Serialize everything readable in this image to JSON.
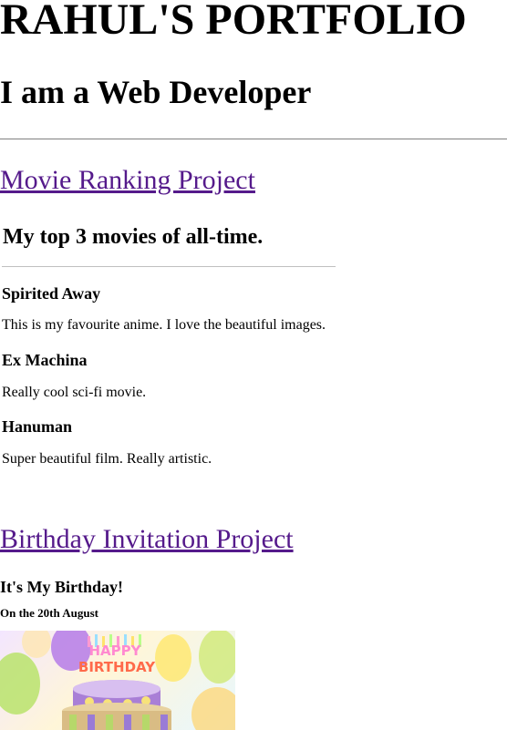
{
  "header": {
    "title": "RAHUL'S PORTFOLIO",
    "subtitle": "I am a Web Developer"
  },
  "projects": {
    "movie": {
      "link_label": "Movie Ranking Project",
      "heading": "My top 3 movies of all-time.",
      "movies": [
        {
          "title": "Spirited Away",
          "description": "This is my favourite anime. I love the beautiful images."
        },
        {
          "title": "Ex Machina",
          "description": "Really cool sci-fi movie."
        },
        {
          "title": "Hanuman",
          "description": "Super beautiful film. Really artistic."
        }
      ]
    },
    "birthday": {
      "link_label": "Birthday Invitation Project",
      "heading": "It's My Birthday!",
      "date": "On the 20th August",
      "image_text": {
        "line1": "HAPPY",
        "line2": "BIRTHDAY"
      }
    }
  },
  "colors": {
    "link": "#551a8b",
    "divider": "#808080"
  }
}
